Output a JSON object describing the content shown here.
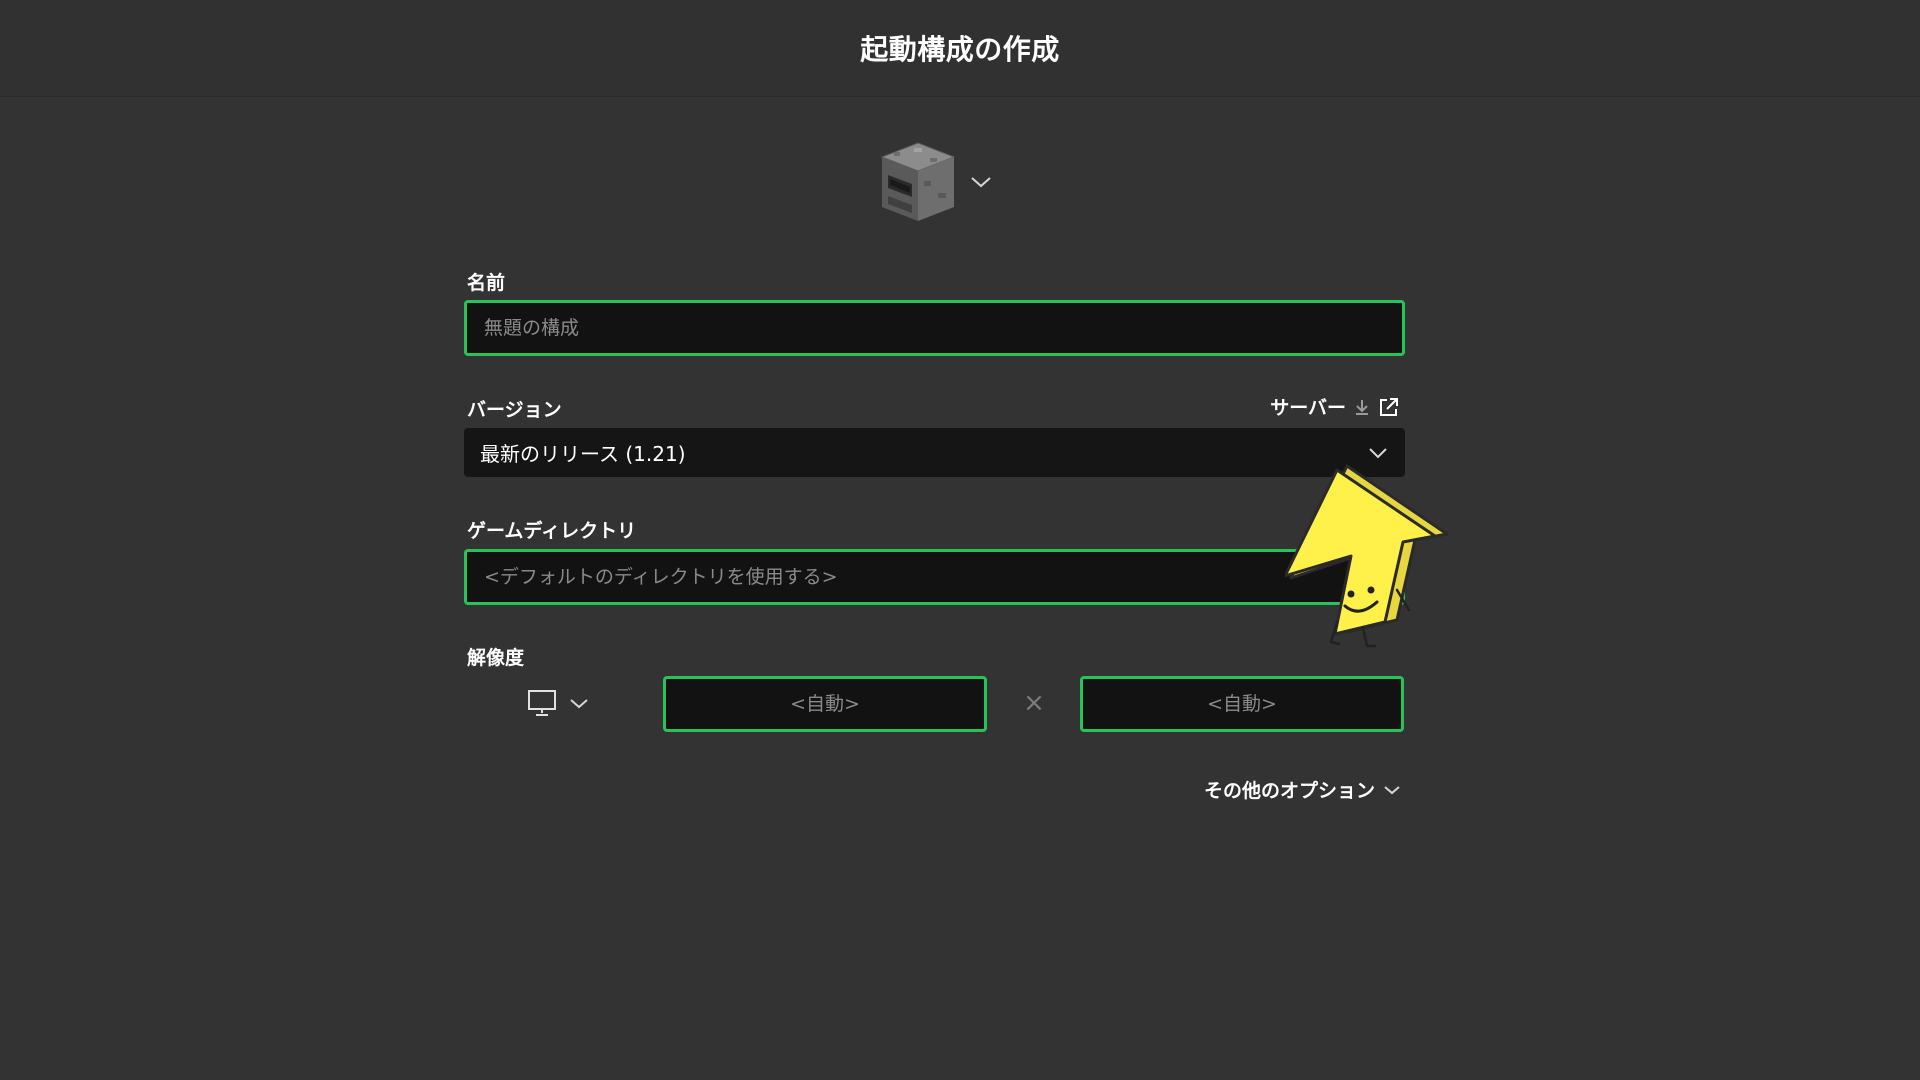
{
  "header": {
    "title": "起動構成の作成"
  },
  "icon_picker": {
    "icon": "furnace-icon",
    "chevron": "chevron-down-icon"
  },
  "name_field": {
    "label": "名前",
    "value": "",
    "placeholder": "無題の構成"
  },
  "version_field": {
    "label": "バージョン",
    "selected": "最新のリリース (1.21)",
    "server_link": "サーバー"
  },
  "directory_field": {
    "label": "ゲームディレクトリ",
    "value": "",
    "placeholder": "<デフォルトのディレクトリを使用する>"
  },
  "resolution": {
    "label": "解像度",
    "monitor_icon": "monitor-icon",
    "width_placeholder": "<自動>",
    "height_placeholder": "<自動>",
    "separator": "×"
  },
  "more_options": {
    "label": "その他のオプション"
  },
  "colors": {
    "background": "#333333",
    "accent": "#27c35a",
    "input_bg": "#121212"
  }
}
